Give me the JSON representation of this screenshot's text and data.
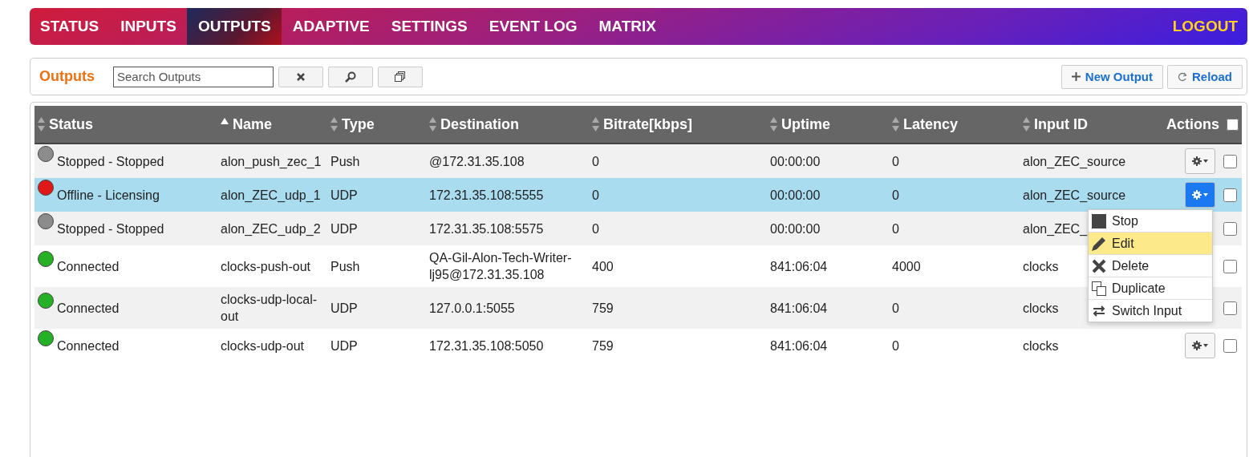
{
  "nav": {
    "tabs": [
      {
        "label": "STATUS",
        "selected": false
      },
      {
        "label": "INPUTS",
        "selected": false
      },
      {
        "label": "OUTPUTS",
        "selected": true
      },
      {
        "label": "ADAPTIVE",
        "selected": false
      },
      {
        "label": "SETTINGS",
        "selected": false
      },
      {
        "label": "EVENT LOG",
        "selected": false
      },
      {
        "label": "MATRIX",
        "selected": false
      }
    ],
    "logout": "LOGOUT"
  },
  "toolbar": {
    "title": "Outputs",
    "search": {
      "placeholder": "Search Outputs"
    },
    "new_button": "New Output",
    "reload_button": "Reload"
  },
  "table": {
    "columns": [
      {
        "label": "Status",
        "sorted": false
      },
      {
        "label": "Name",
        "sorted": true
      },
      {
        "label": "Type",
        "sorted": false
      },
      {
        "label": "Destination",
        "sorted": false
      },
      {
        "label": "Bitrate[kbps]",
        "sorted": false
      },
      {
        "label": "Uptime",
        "sorted": false
      },
      {
        "label": "Latency",
        "sorted": false
      },
      {
        "label": "Input ID",
        "sorted": false
      },
      {
        "label": "Actions"
      }
    ],
    "select_all": false,
    "rows": [
      {
        "status": "Stopped - Stopped",
        "color": "#8c8c8c",
        "name": "alon_push_zec_1",
        "type": "Push",
        "destination": "@172.31.35.108",
        "bitrate": "0",
        "uptime": "00:00:00",
        "latency": "0",
        "input_id": "alon_ZEC_source",
        "selected": false,
        "actions_button": true,
        "checked": false
      },
      {
        "status": "Offline - Licensing",
        "color": "#e01818",
        "name": "alon_ZEC_udp_1",
        "type": "UDP",
        "destination": "172.31.35.108:5555",
        "bitrate": "0",
        "uptime": "00:00:00",
        "latency": "0",
        "input_id": "alon_ZEC_source",
        "selected": true,
        "actions_button": true,
        "checked": false
      },
      {
        "status": "Stopped - Stopped",
        "color": "#8c8c8c",
        "name": "alon_ZEC_udp_2",
        "type": "UDP",
        "destination": "172.31.35.108:5575",
        "bitrate": "0",
        "uptime": "00:00:00",
        "latency": "0",
        "input_id": "alon_ZEC_",
        "selected": false,
        "actions_button": false,
        "checked": false
      },
      {
        "status": "Connected",
        "color": "#26b026",
        "name": "clocks-push-out",
        "type": "Push",
        "destination": "QA-Gil-Alon-Tech-Writer-lj95@172.31.35.108",
        "bitrate": "400",
        "uptime": "841:06:04",
        "latency": "4000",
        "input_id": "clocks",
        "selected": false,
        "actions_button": false,
        "checked": false
      },
      {
        "status": "Connected",
        "color": "#26b026",
        "name": "clocks-udp-local-out",
        "type": "UDP",
        "destination": "127.0.0.1:5055",
        "bitrate": "759",
        "uptime": "841:06:04",
        "latency": "0",
        "input_id": "clocks",
        "selected": false,
        "actions_button": false,
        "checked": false
      },
      {
        "status": "Connected",
        "color": "#26b026",
        "name": "clocks-udp-out",
        "type": "UDP",
        "destination": "172.31.35.108:5050",
        "bitrate": "759",
        "uptime": "841:06:04",
        "latency": "0",
        "input_id": "clocks",
        "selected": false,
        "actions_button": true,
        "checked": false
      }
    ]
  },
  "action_menu": {
    "items": [
      {
        "kind": "stop",
        "label": "Stop",
        "highlighted": false
      },
      {
        "kind": "edit",
        "label": "Edit",
        "highlighted": true
      },
      {
        "kind": "delete",
        "label": "Delete",
        "highlighted": false
      },
      {
        "kind": "duplicate",
        "label": "Duplicate",
        "highlighted": false
      },
      {
        "kind": "switch",
        "label": "Switch Input",
        "highlighted": false
      }
    ]
  }
}
